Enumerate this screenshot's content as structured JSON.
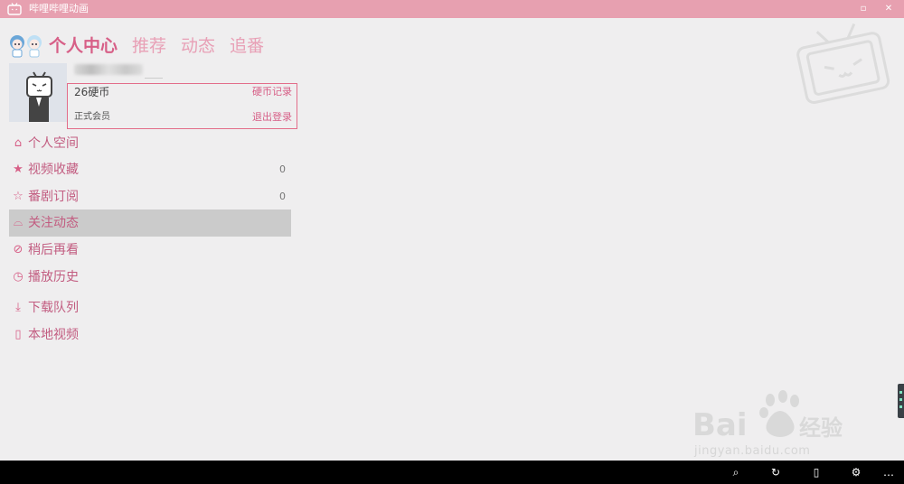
{
  "window": {
    "title": "哔哩哔哩动画",
    "max_glyph": "▫",
    "close_glyph": "✕"
  },
  "tabs": [
    {
      "label": "个人中心",
      "active": true
    },
    {
      "label": "推荐",
      "active": false
    },
    {
      "label": "动态",
      "active": false
    },
    {
      "label": "追番",
      "active": false
    }
  ],
  "profile": {
    "coins": "26硬币",
    "coin_record": "硬币记录",
    "member_level": "正式会员",
    "logout": "退出登录"
  },
  "menu": [
    {
      "label": "个人空间",
      "icon": "home-icon",
      "glyph": "⌂",
      "count": ""
    },
    {
      "label": "视频收藏",
      "icon": "star-filled-icon",
      "glyph": "★",
      "count": "0"
    },
    {
      "label": "番剧订阅",
      "icon": "star-outline-icon",
      "glyph": "☆",
      "count": "0"
    },
    {
      "label": "关注动态",
      "icon": "inbox-icon",
      "glyph": "⌓",
      "count": "",
      "selected": true
    },
    {
      "label": "稍后再看",
      "icon": "tag-icon",
      "glyph": "⊘",
      "count": ""
    },
    {
      "label": "播放历史",
      "icon": "clock-icon",
      "glyph": "◷",
      "count": ""
    },
    {
      "label": "下载队列",
      "icon": "download-icon",
      "glyph": "⤓",
      "count": ""
    },
    {
      "label": "本地视频",
      "icon": "local-video-icon",
      "glyph": "▯",
      "count": ""
    }
  ],
  "appbar": {
    "search": "⌕",
    "refresh": "↻",
    "device": "▯",
    "settings": "⚙",
    "more": "…"
  },
  "watermark": {
    "url": "jingyan.baidu.com"
  },
  "colors": {
    "accent": "#d75f87",
    "titlebar": "#e7a0b0",
    "tab_inactive": "#e8a0b6",
    "background": "#efeeef"
  }
}
